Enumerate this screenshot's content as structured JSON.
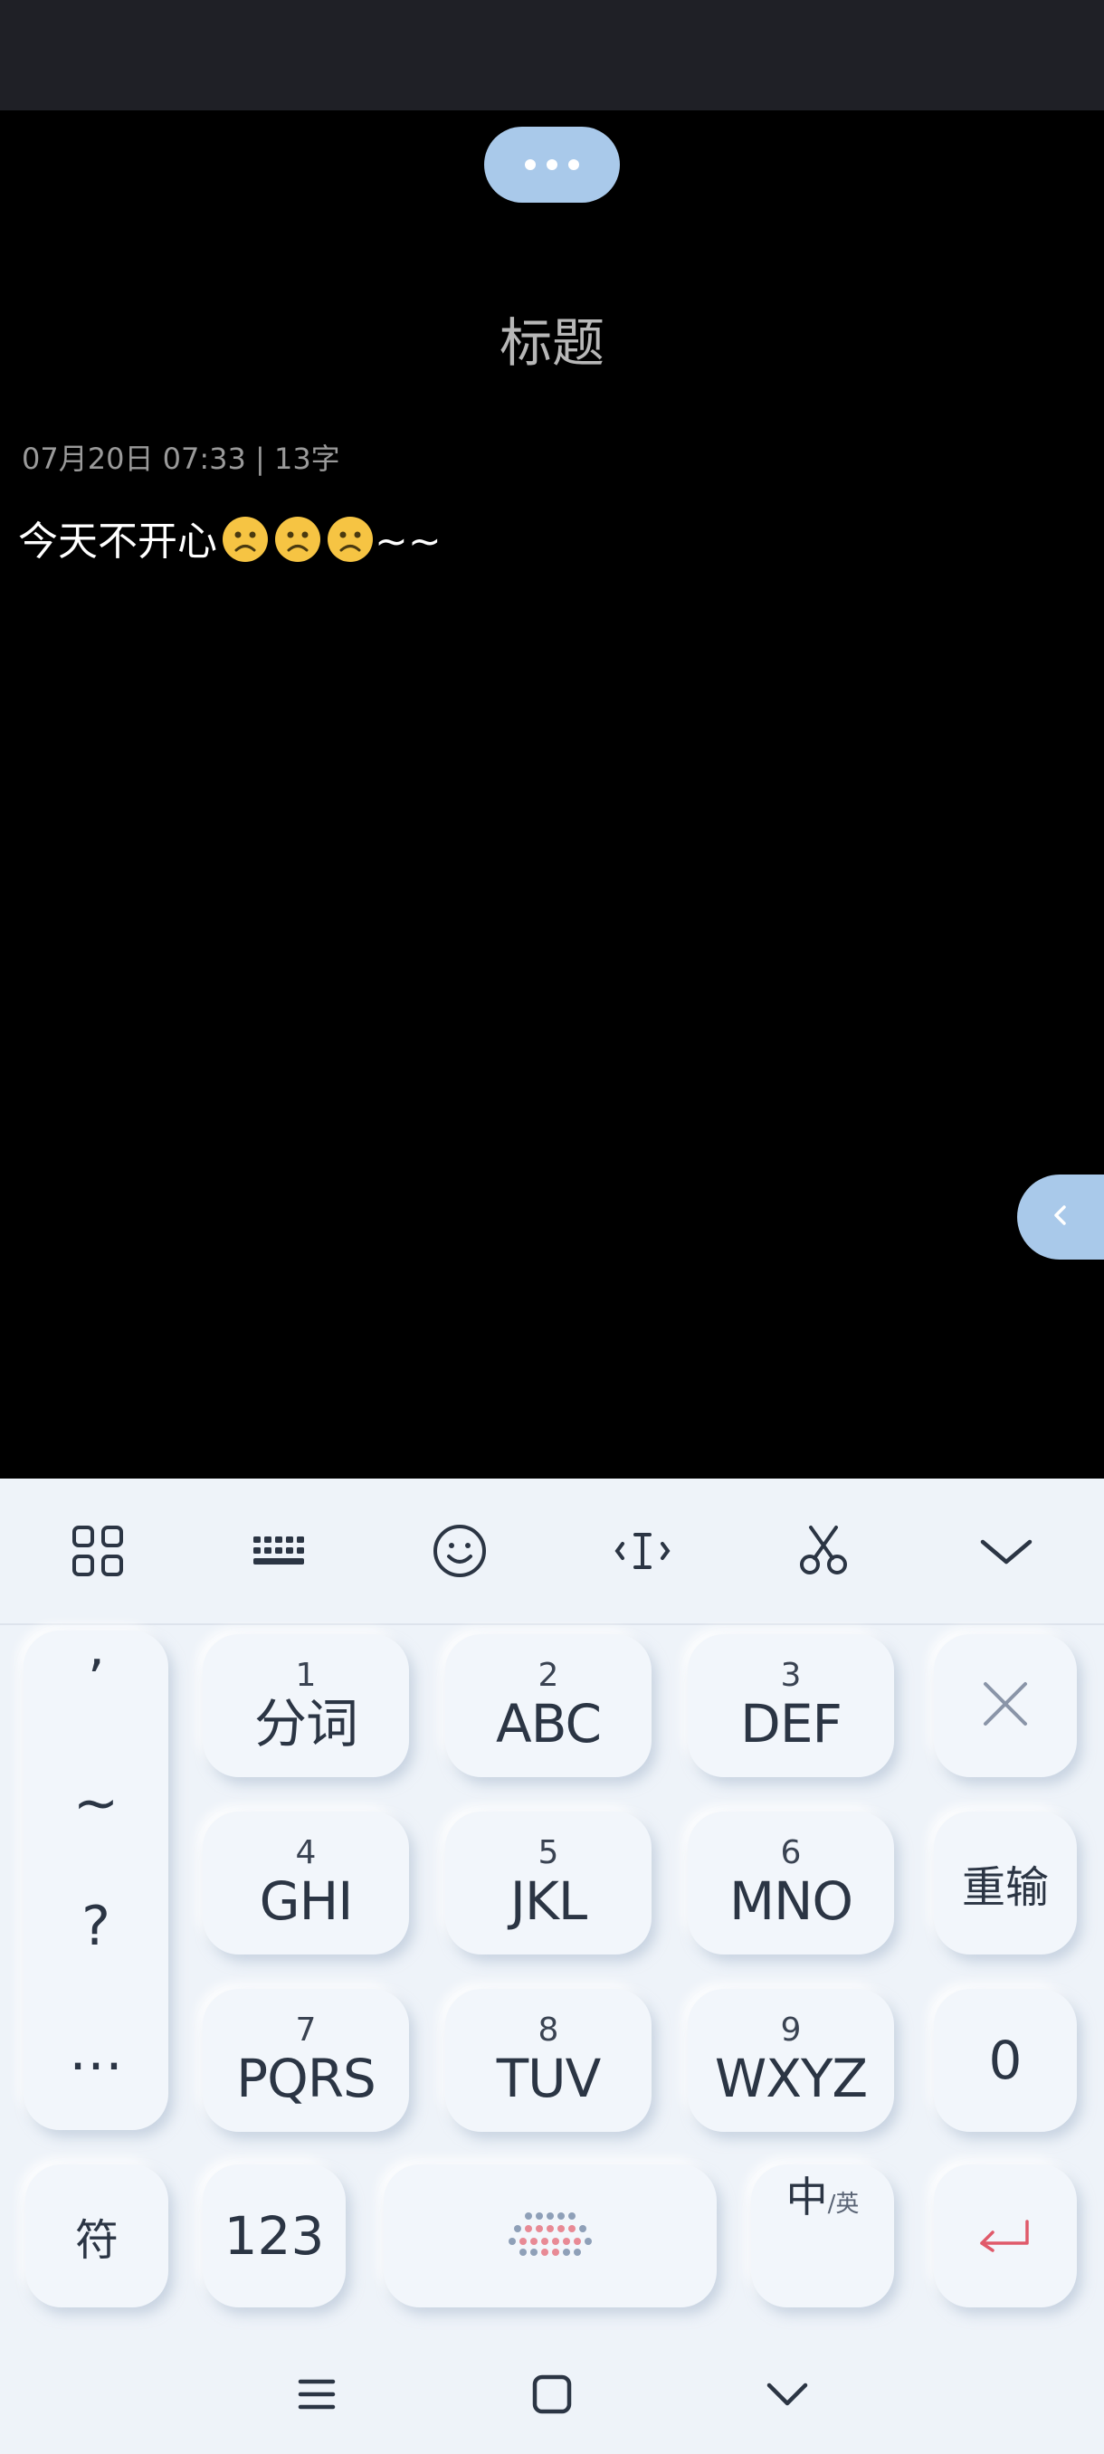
{
  "note": {
    "title": "标题",
    "meta": "07月20日 07:33 | 13字",
    "body": "今天不开心",
    "emoji_count": 3,
    "tail": "~~"
  },
  "toolbar": {
    "icons": [
      "grid-icon",
      "keyboard-icon",
      "emoji-icon",
      "cursor-icon",
      "scissors-icon",
      "chevron-down-icon"
    ]
  },
  "keyboard": {
    "punct": [
      "’",
      "~",
      "?",
      "…"
    ],
    "keys": [
      {
        "num": "1",
        "letters": "分词"
      },
      {
        "num": "2",
        "letters": "ABC"
      },
      {
        "num": "3",
        "letters": "DEF"
      },
      {
        "num": "4",
        "letters": "GHI"
      },
      {
        "num": "5",
        "letters": "JKL"
      },
      {
        "num": "6",
        "letters": "MNO"
      },
      {
        "num": "7",
        "letters": "PQRS"
      },
      {
        "num": "8",
        "letters": "TUV"
      },
      {
        "num": "9",
        "letters": "WXYZ"
      }
    ],
    "reenter": "重输",
    "zero": "0",
    "symbol": "符",
    "numbers": "123",
    "lang_main": "中",
    "lang_sub": "/英"
  },
  "colors": {
    "accent": "#a9c9ea",
    "enter": "#e05a6a",
    "key_text": "#2b3544"
  }
}
